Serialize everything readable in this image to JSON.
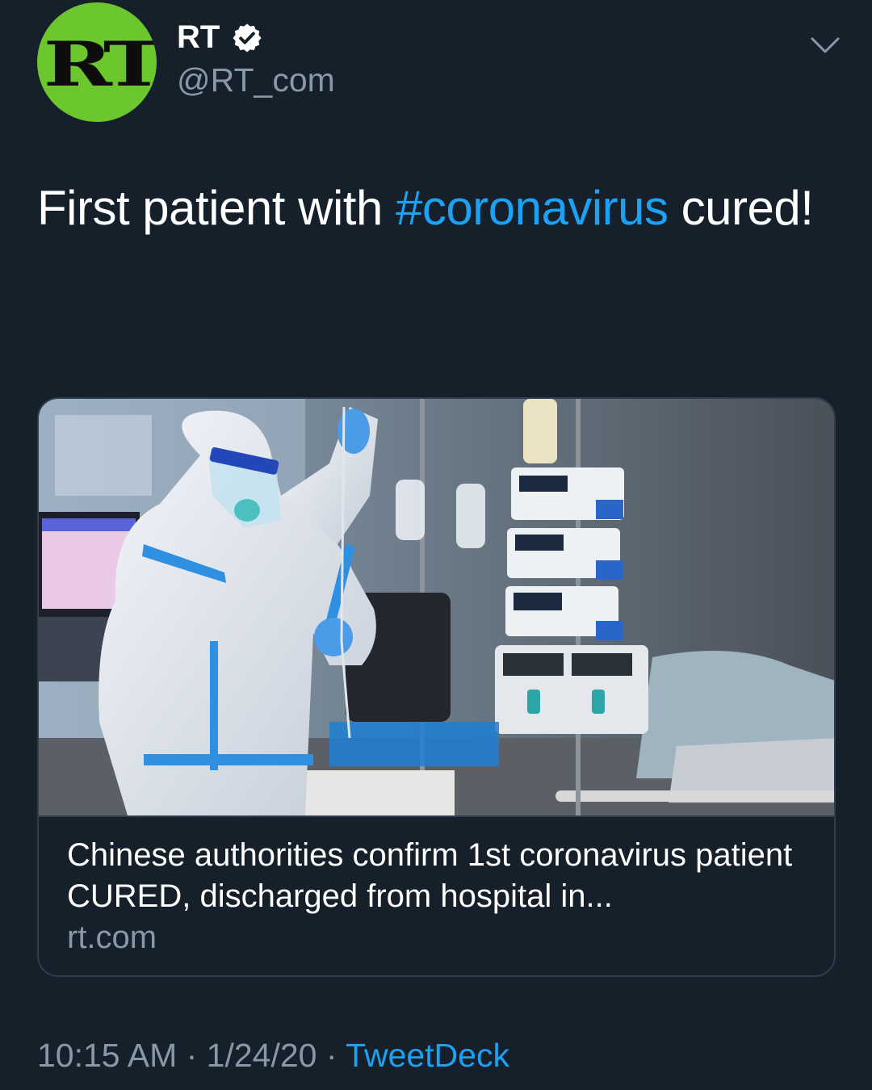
{
  "tweet": {
    "author": {
      "avatar_text": "RT",
      "display_name": "RT",
      "handle": "@RT_com",
      "verified": true
    },
    "text_before": "First patient with ",
    "hashtag": "#coronavirus",
    "text_after": " cured!",
    "card": {
      "title": "Chinese authorities confirm 1st coronavirus patient CURED, discharged from hospital in...",
      "domain": "rt.com"
    },
    "time": "10:15 AM",
    "separator": " · ",
    "date": "1/24/20",
    "source": "TweetDeck"
  },
  "colors": {
    "background": "#15202b",
    "accent": "#1da1f2",
    "secondary_text": "#8899a6",
    "avatar_green": "#6cc72e",
    "border": "#2f3d4c"
  },
  "icons": {
    "verified": "verified-badge-icon",
    "caret": "chevron-down-icon"
  }
}
